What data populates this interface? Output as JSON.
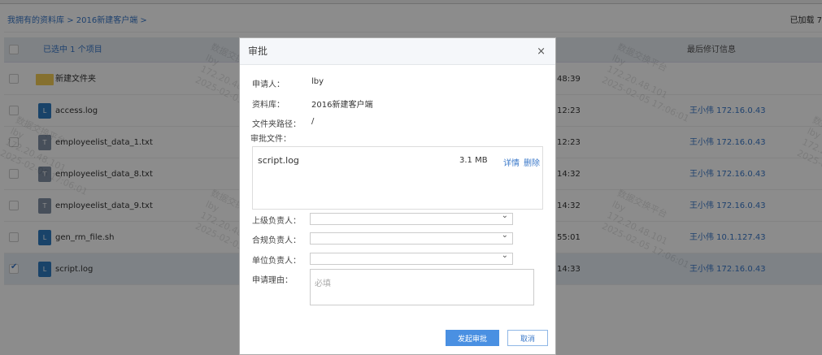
{
  "breadcrumb": [
    "我拥有的资料库",
    "2016新建客户端"
  ],
  "breadcrumb_sep": ">",
  "loaded_text": "已加载 7",
  "table": {
    "selected_text": "已选中 1 个项目",
    "last_rev_header": "最后修订信息",
    "rows": [
      {
        "name": "新建文件夹",
        "type": "folder",
        "time": "48:39",
        "rev": "",
        "checked": false
      },
      {
        "name": "access.log",
        "type": "log",
        "time": "12:23",
        "rev": "王小伟 172.16.0.43",
        "checked": false
      },
      {
        "name": "employeelist_data_1.txt",
        "type": "txt",
        "time": "12:23",
        "rev": "王小伟 172.16.0.43",
        "checked": false
      },
      {
        "name": "employeelist_data_8.txt",
        "type": "txt",
        "time": "14:32",
        "rev": "王小伟 172.16.0.43",
        "checked": false
      },
      {
        "name": "employeelist_data_9.txt",
        "type": "txt",
        "time": "14:32",
        "rev": "王小伟 172.16.0.43",
        "checked": false
      },
      {
        "name": "gen_rm_file.sh",
        "type": "log",
        "time": "55:01",
        "rev": "王小伟 10.1.127.43",
        "checked": false
      },
      {
        "name": "script.log",
        "type": "log",
        "time": "14:33",
        "rev": "王小伟 172.16.0.43",
        "checked": true
      }
    ]
  },
  "watermark": [
    "数据交换平台",
    "lby",
    "172.20.48.101",
    "2025-02-05 17:06:01"
  ],
  "modal": {
    "title": "审批",
    "close": "×",
    "applicant_label": "申请人：",
    "applicant": "lby",
    "library_label": "资料库：",
    "library": "2016新建客户端",
    "path_label": "文件夹路径：",
    "path": "/",
    "files_label": "审批文件：",
    "file": {
      "name": "script.log",
      "size": "3.1 MB",
      "detail": "详情",
      "delete": "删除"
    },
    "superior_label": "上级负责人：",
    "compliance_label": "合规负责人：",
    "unit_label": "单位负责人：",
    "reason_label": "申请理由：",
    "reason_placeholder": "必填",
    "submit": "发起审批",
    "cancel": "取消"
  }
}
